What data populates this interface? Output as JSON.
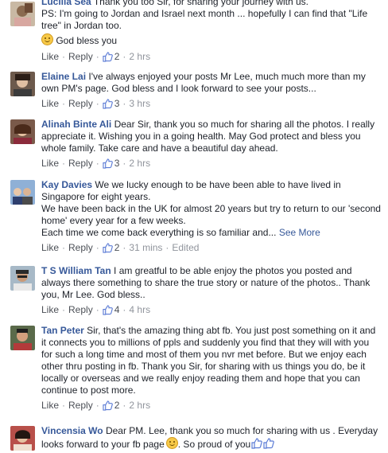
{
  "actions": {
    "like": "Like",
    "reply": "Reply",
    "separator": "·"
  },
  "comments": [
    {
      "name": "Lucilla Sea",
      "lines": [
        "Thank you too Sir, for sharing your journey with us.",
        "PS: I'm going to Jordan and Israel next month ... hopefully I can find that \"Life tree\" in Jordan too."
      ],
      "emoji_line": "God bless you",
      "likes": "2",
      "time": "2 hrs"
    },
    {
      "name": "Elaine Lai",
      "text": "I've always enjoyed your posts Mr Lee, much much more than my own PM's page. God bless and I look forward to see your posts...",
      "likes": "3",
      "time": "3 hrs"
    },
    {
      "name": "Alinah Binte Ali",
      "text": "Dear Sir, thank you so much for sharing all the photos. I really appreciate it. Wishing you in a going health. May God protect and bless you whole family. Take care and have a beautiful day ahead.",
      "likes": "3",
      "time": "2 hrs"
    },
    {
      "name": "Kay Davies",
      "lines": [
        "We we lucky enough to be have been able to have lived in Singapore for eight years.",
        "We have been back in the UK for almost 20 years but try to return to our 'second home' every year for a few weeks."
      ],
      "last_line": "Each time we come back everything is so familiar and...",
      "see_more": "See More",
      "likes": "2",
      "time": "31 mins",
      "edited": "Edited"
    },
    {
      "name": "T S William Tan",
      "text": "I am greatful to be able enjoy the photos you posted and always there something to share the true story or nature of the photos.. Thank you, Mr Lee. God bless..",
      "likes": "4",
      "time": "4 hrs"
    },
    {
      "name": "Tan Peter",
      "text": "Sir, that's the amazing thing abt fb. You just post something on it and it connects you to millions of ppls and suddenly you find that they will with you for such a long time and most of them you nvr met before. But we enjoy each other thru posting in fb. Thank you Sir, for sharing with us things you do, be it locally or overseas and we really enjoy reading them and hope that you can continue to post more.",
      "likes": "2",
      "time": "2 hrs"
    },
    {
      "name": "Vincensia Wo",
      "text": "Dear PM. Lee, thank you so much for sharing with us . Everyday looks forward to your fb page",
      "text_after_emoji": ". So proud of you"
    }
  ],
  "colors": {
    "name": "#365899",
    "meta": "#90949c",
    "link": "#4b4f56",
    "like_blue": "#5b7bd5"
  },
  "icons": {
    "like": "thumbs-up-icon",
    "smile": "smiling-face-emoji"
  }
}
